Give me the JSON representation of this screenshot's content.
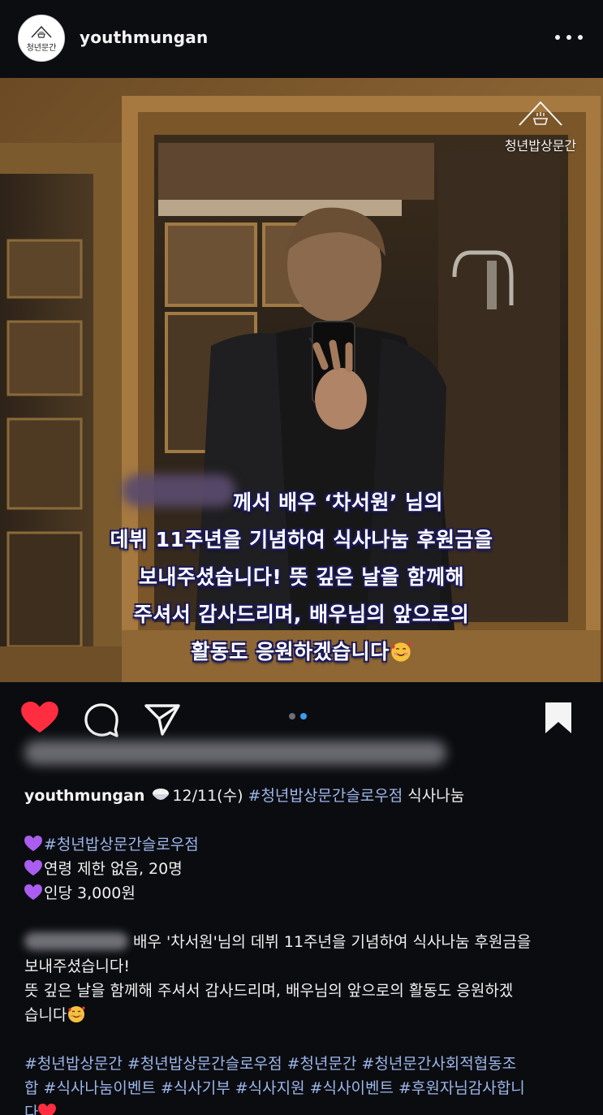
{
  "header": {
    "username": "youthmungan",
    "avatar_text": "청년문간",
    "more_icon": "more-horizontal-icon"
  },
  "photo": {
    "brand_text": "청년밥상문간",
    "overlay_lines": [
      "께서 배우 ‘차서원’ 님의",
      "데뷔 11주년을 기념하여 식사나눔 후원금을",
      "보내주셨습니다! 뜻 깊은 날을 함께해",
      "주셔서 감사드리며, 배우님의 앞으로의",
      "활동도 응원하겠습니다"
    ]
  },
  "actions": {
    "like_icon": "heart-filled-icon",
    "comment_icon": "comment-icon",
    "share_icon": "send-icon",
    "save_icon": "bookmark-filled-icon",
    "carousel": {
      "count": 2,
      "active": 2
    },
    "colors": {
      "like": "#ff2d3f",
      "dot_active": "#3d9bf5",
      "dot_inactive": "#6d6f78"
    }
  },
  "caption": {
    "username": "youthmungan",
    "date": "12/11(수)",
    "headline_tag": "#청년밥상문간슬로우점",
    "headline_rest": " 식사나눔",
    "info": [
      "#청년밥상문간슬로우점",
      "연령 제한 없음, 20명",
      "인당 3,000원"
    ],
    "body_lines": [
      "배우 '차서원'님의 데뷔 11주년을 기념하여 식사나눔 후원금을",
      "보내주셨습니다!",
      "뜻 깊은 날을 함께해 주셔서 감사드리며, 배우님의 앞으로의 활동도 응원하겠",
      "습니다"
    ],
    "hashtag_lines": [
      "#청년밥상문간 #청년밥상문간슬로우점 #청년문간 #청년문간사회적협동조",
      "합 #식사나눔이벤트 #식사기부 #식사지원 #식사이벤트 #후원자님감사합니",
      "다"
    ],
    "tag_color": "#9cb6ea"
  }
}
